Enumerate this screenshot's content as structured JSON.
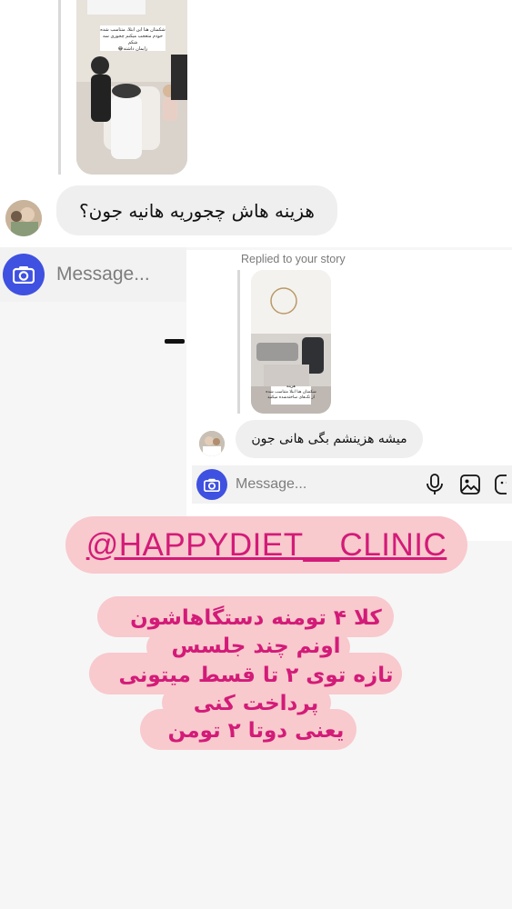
{
  "thread1": {
    "story_caption": "شکمتان هنا این ابتلا، متناسب شده\nخودم متعجب میکنم چجوری سه شکم\nزایمان داشته😂",
    "message_text": "هزینه هاش چجوریه هانیه جون؟",
    "composer_placeholder": "Message..."
  },
  "thread2": {
    "replied_label": "Replied to your story",
    "story_caption_a": "هزینه",
    "story_caption_b": "شکمتان هنا ابتلا متناسب شده",
    "story_caption_c": "از تک‌های ساخته‌شده میکنید",
    "message_text": "میشه هزینشم بگی هانی جون",
    "composer_placeholder": "Message..."
  },
  "overlay": {
    "handle": "@HAPPYDIET__CLINIC",
    "lines": [
      "کلا ۴ تومنه دستگاهاشون",
      "اونم چند جلسس",
      "تازه توی ۲ تا قسط میتونی",
      "پرداخت کنی",
      "یعنی دوتا ۲ تومن"
    ]
  },
  "colors": {
    "accent_blue": "#3f51e0",
    "pink_background": "#f8c9cd",
    "magenta_text": "#d31b78",
    "bubble_gray": "#efefef"
  },
  "icons": [
    "camera-icon",
    "microphone-icon",
    "gallery-icon",
    "sticker-icon"
  ]
}
